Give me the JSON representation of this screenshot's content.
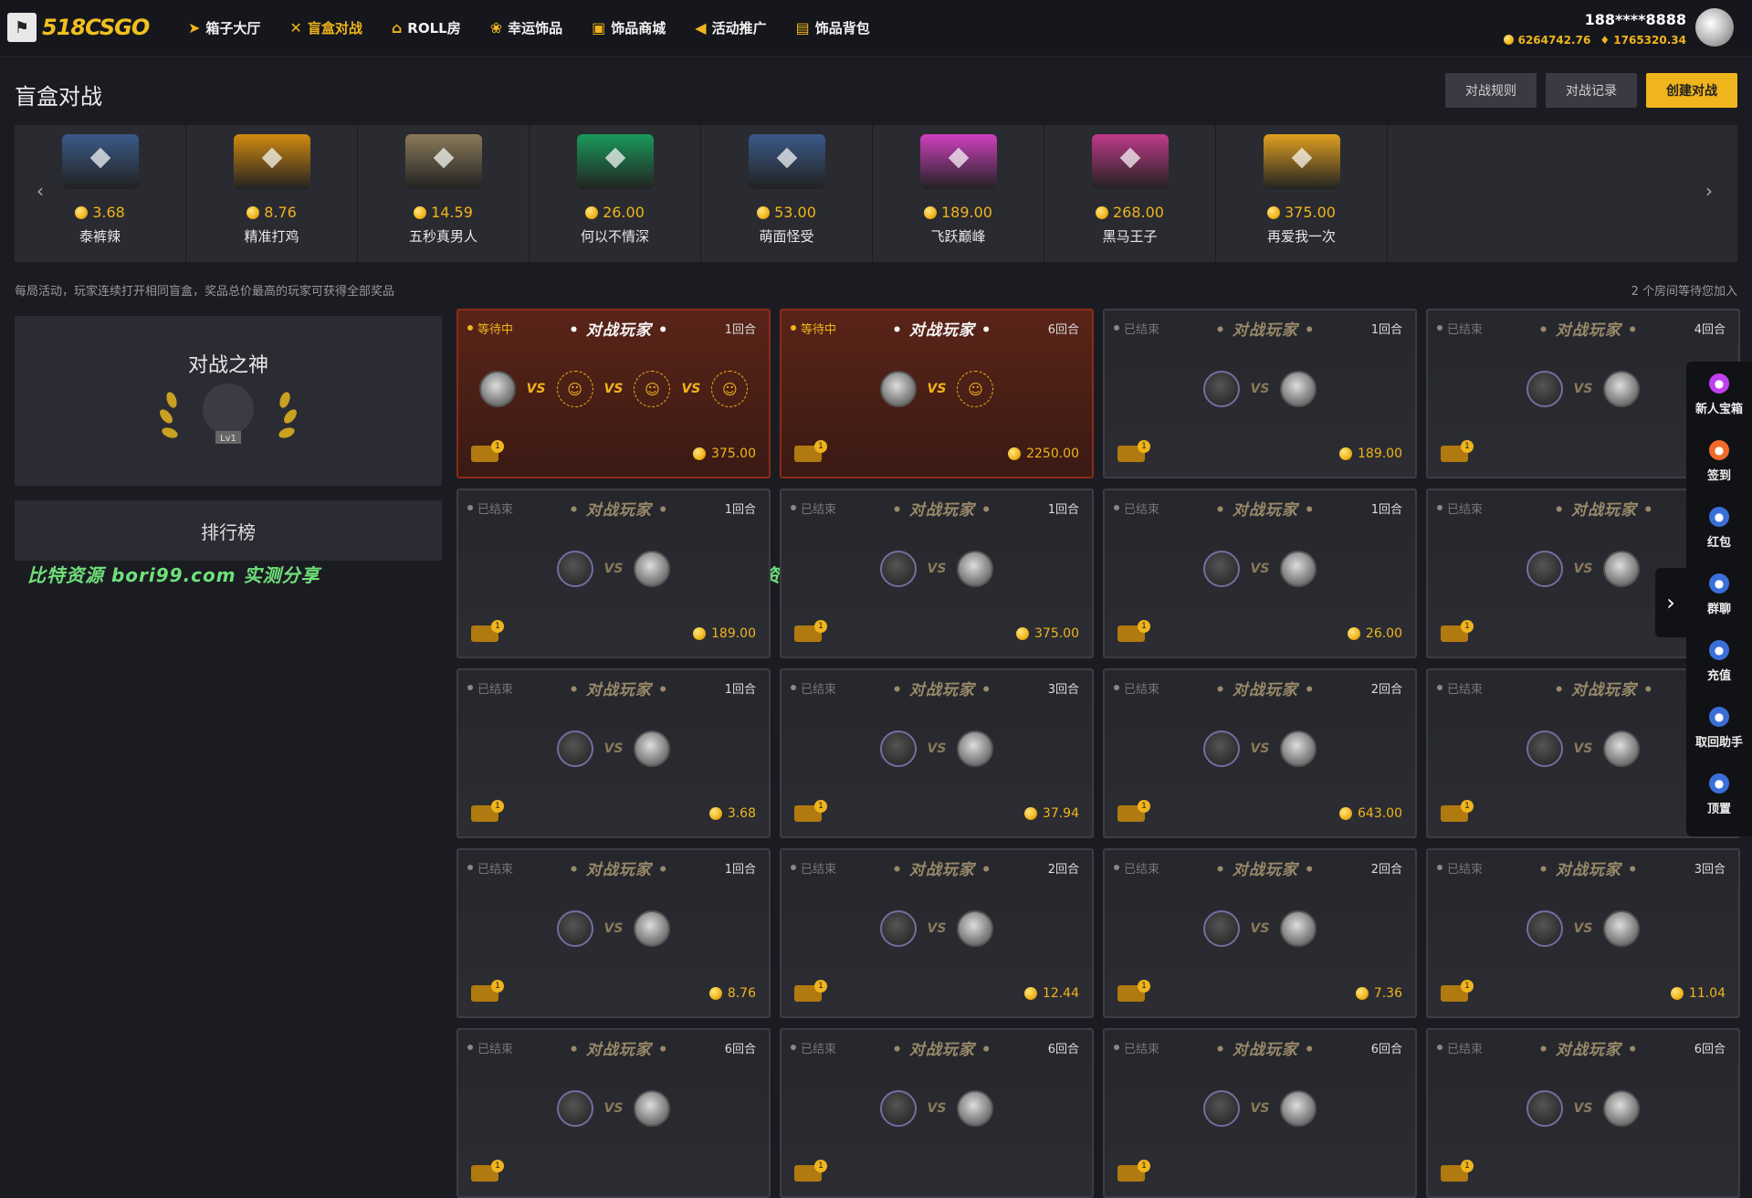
{
  "header": {
    "logo_text": "518CSGO",
    "nav": [
      {
        "label": "箱子大厅",
        "icon": "paper-plane-icon"
      },
      {
        "label": "盲盒对战",
        "icon": "swords-icon",
        "active": true
      },
      {
        "label": "ROLL房",
        "icon": "home-icon"
      },
      {
        "label": "幸运饰品",
        "icon": "lucky-icon"
      },
      {
        "label": "饰品商城",
        "icon": "shopping-bag-icon"
      },
      {
        "label": "活动推广",
        "icon": "megaphone-icon"
      },
      {
        "label": "饰品背包",
        "icon": "backpack-icon"
      }
    ],
    "user": {
      "name": "188****8888",
      "coins": "6264742.76",
      "diamonds": "1765320.34"
    }
  },
  "page": {
    "title": "盲盒对战",
    "buttons": {
      "rules": "对战规则",
      "records": "对战记录",
      "create": "创建对战"
    }
  },
  "cases": [
    {
      "price": "3.68",
      "name": "泰裤辣",
      "color": "#3a5a8a"
    },
    {
      "price": "8.76",
      "name": "精准打鸡",
      "color": "#d08a10"
    },
    {
      "price": "14.59",
      "name": "五秒真男人",
      "color": "#8a7a5a"
    },
    {
      "price": "26.00",
      "name": "何以不情深",
      "color": "#1a9a5a"
    },
    {
      "price": "53.00",
      "name": "萌面怪受",
      "color": "#3a5a8a"
    },
    {
      "price": "189.00",
      "name": "飞跃巅峰",
      "color": "#d040c0"
    },
    {
      "price": "268.00",
      "name": "黑马王子",
      "color": "#c03a8a"
    },
    {
      "price": "375.00",
      "name": "再爱我一次",
      "color": "#e0a020"
    }
  ],
  "notice": "每局活动，玩家连续打开相同盲盒，奖品总价最高的玩家可获得全部奖品",
  "waiting_text": "2 个房间等待您加入",
  "god": {
    "title": "对战之神",
    "level": "Lv1"
  },
  "rank_label": "排行榜",
  "watermark": "比特资源 bori99.com 实测分享",
  "card_title": "对战玩家",
  "cards": [
    {
      "status": "等待中",
      "rounds": "1回合",
      "value": "375.00",
      "wait": true
    },
    {
      "status": "等待中",
      "rounds": "6回合",
      "value": "2250.00",
      "wait": true
    },
    {
      "status": "已结束",
      "rounds": "1回合",
      "value": "189.00"
    },
    {
      "status": "已结束",
      "rounds": "4回合",
      "value": ""
    },
    {
      "status": "已结束",
      "rounds": "1回合",
      "value": "189.00"
    },
    {
      "status": "已结束",
      "rounds": "1回合",
      "value": "375.00"
    },
    {
      "status": "已结束",
      "rounds": "1回合",
      "value": "26.00"
    },
    {
      "status": "已结束",
      "rounds": "",
      "value": ""
    },
    {
      "status": "已结束",
      "rounds": "1回合",
      "value": "3.68"
    },
    {
      "status": "已结束",
      "rounds": "3回合",
      "value": "37.94"
    },
    {
      "status": "已结束",
      "rounds": "2回合",
      "value": "643.00"
    },
    {
      "status": "已结束",
      "rounds": "",
      "value": ""
    },
    {
      "status": "已结束",
      "rounds": "1回合",
      "value": "8.76"
    },
    {
      "status": "已结束",
      "rounds": "2回合",
      "value": "12.44"
    },
    {
      "status": "已结束",
      "rounds": "2回合",
      "value": "7.36"
    },
    {
      "status": "已结束",
      "rounds": "3回合",
      "value": "11.04"
    },
    {
      "status": "已结束",
      "rounds": "6回合",
      "value": ""
    },
    {
      "status": "已结束",
      "rounds": "6回合",
      "value": ""
    },
    {
      "status": "已结束",
      "rounds": "6回合",
      "value": ""
    },
    {
      "status": "已结束",
      "rounds": "6回合",
      "value": ""
    }
  ],
  "sidebar": [
    {
      "label": "新人宝箱",
      "icon": "gift-icon",
      "color": "#c040f0"
    },
    {
      "label": "签到",
      "icon": "checkin-icon",
      "color": "#f06a2a"
    },
    {
      "label": "红包",
      "icon": "red-envelope-icon",
      "color": "#3b6fd8"
    },
    {
      "label": "群聊",
      "icon": "bell-icon",
      "color": "#3b6fd8"
    },
    {
      "label": "充值",
      "icon": "recharge-icon",
      "color": "#3b6fd8"
    },
    {
      "label": "取回助手",
      "icon": "chat-icon",
      "color": "#3b6fd8"
    },
    {
      "label": "顶置",
      "icon": "rocket-icon",
      "color": "#3b6fd8"
    }
  ]
}
